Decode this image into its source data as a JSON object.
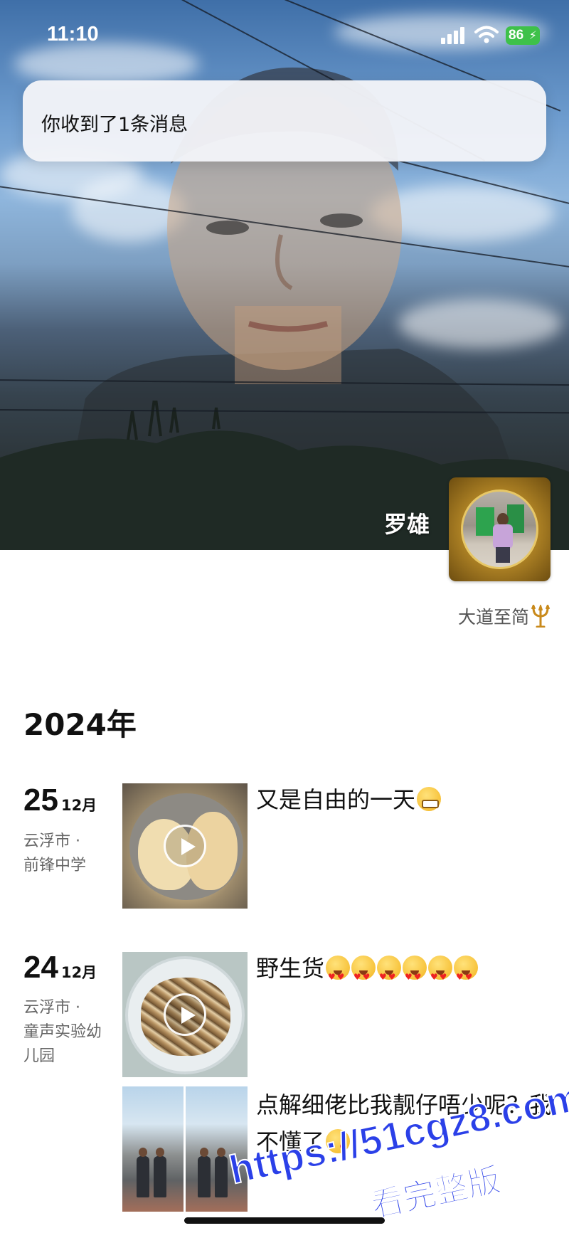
{
  "status_bar": {
    "time": "11:10",
    "battery": "86",
    "colors": {
      "battery": "#3ec14a"
    }
  },
  "notification": {
    "text": "你收到了1条消息"
  },
  "profile": {
    "name": "罗雄",
    "signature": "大道至简"
  },
  "timeline": {
    "year": "2024年",
    "posts": [
      {
        "day": "25",
        "month": "12月",
        "location_city": "云浮市 ·",
        "location_place": "前锋中学",
        "text": "又是自由的一天",
        "media": "video",
        "emojis": [
          "grin"
        ]
      },
      {
        "day": "24",
        "month": "12月",
        "location_city": "云浮市 ·",
        "location_place": "童声实验幼儿园",
        "text": "野生货",
        "media": "video",
        "emojis": [
          "heart-eyes",
          "heart-eyes",
          "heart-eyes",
          "heart-eyes",
          "heart-eyes",
          "heart-eyes"
        ]
      },
      {
        "text": "点解细佬比我靓仔唔少呢？我不懂了",
        "media": "photos",
        "emojis": [
          "wink"
        ]
      }
    ]
  },
  "watermark": {
    "line1": "https://51cgz8.com",
    "line2": "看完整版"
  },
  "icons": [
    "signal-icon",
    "wifi-icon",
    "battery-icon",
    "trident-icon",
    "play-icon"
  ]
}
